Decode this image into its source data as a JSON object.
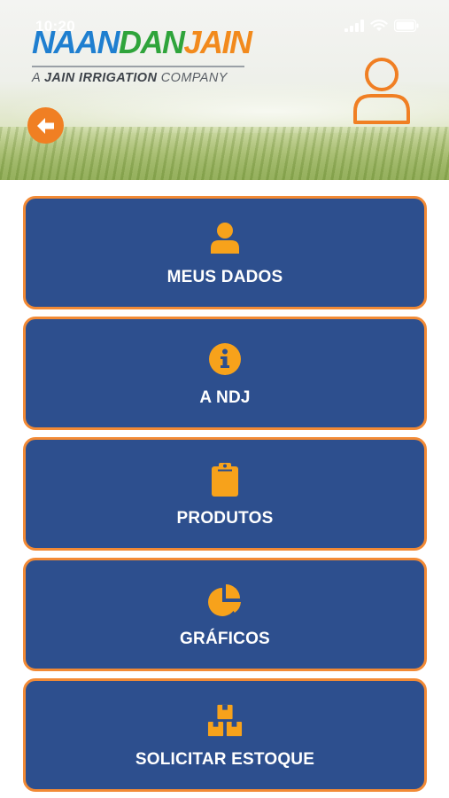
{
  "status_bar": {
    "time": "10:20"
  },
  "header": {
    "logo": {
      "brand_part1": "NAAN",
      "brand_part2": "DAN",
      "brand_part3": "JAIN",
      "tagline_prefix": "A ",
      "tagline_bold": "JAIN IRRIGATION",
      "tagline_suffix": " COMPANY"
    },
    "back_icon": "arrow-left-icon",
    "profile_icon": "user-outline-icon"
  },
  "colors": {
    "accent": "#f28a35",
    "card_blue": "#2d4f8e",
    "icon_yellow": "#f7a21b",
    "logo_blue": "#1f7fd0",
    "logo_green": "#2fa43b",
    "logo_orange": "#f28a1d"
  },
  "menu": {
    "items": [
      {
        "label": "MEUS DADOS",
        "icon": "user-icon"
      },
      {
        "label": "A NDJ",
        "icon": "info-icon"
      },
      {
        "label": "PRODUTOS",
        "icon": "clipboard-icon"
      },
      {
        "label": "GRÁFICOS",
        "icon": "pie-chart-icon"
      },
      {
        "label": "SOLICITAR ESTOQUE",
        "icon": "boxes-icon"
      }
    ]
  }
}
